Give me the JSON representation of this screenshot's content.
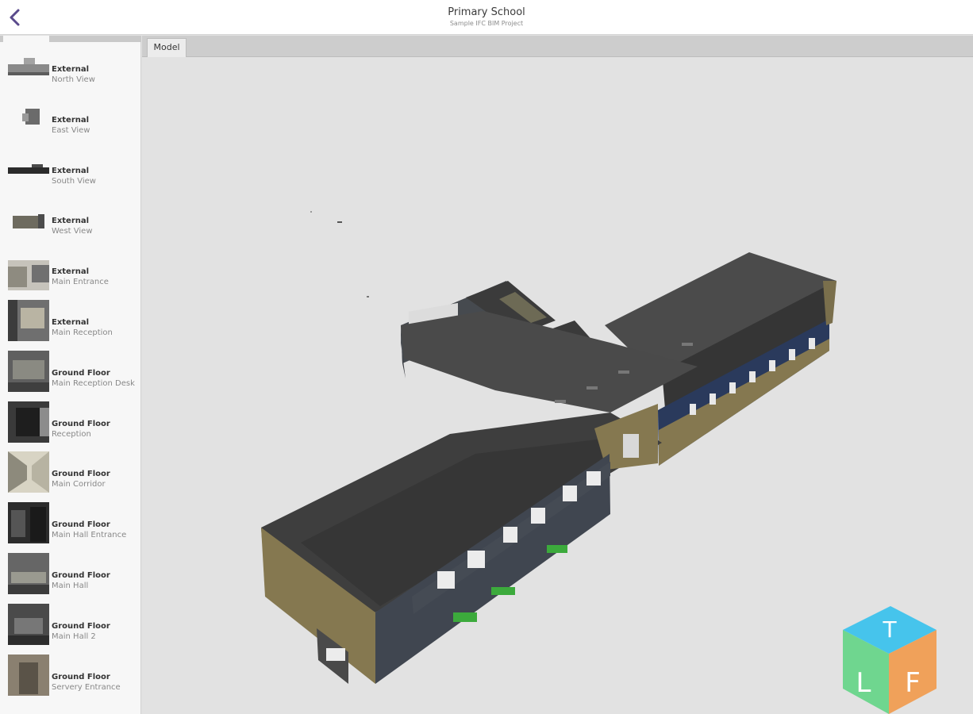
{
  "header": {
    "title": "Primary School",
    "subtitle": "Sample IFC BIM Project",
    "back_icon": "chevron-left-icon"
  },
  "colors": {
    "accent": "#5a4a8c",
    "roof": "#3f3f3f",
    "wall_tan": "#8a7c55",
    "wall_blue": "#27375a",
    "window_green": "#3caa3c",
    "logo_top": "#46c4ec",
    "logo_left": "#6fd68f",
    "logo_right": "#f0a15a"
  },
  "tabs": [
    {
      "label": "Model",
      "active": true
    }
  ],
  "views": [
    {
      "category": "External",
      "name": "North View"
    },
    {
      "category": "External",
      "name": "East View"
    },
    {
      "category": "External",
      "name": "South View"
    },
    {
      "category": "External",
      "name": "West View"
    },
    {
      "category": "External",
      "name": "Main Entrance"
    },
    {
      "category": "External",
      "name": "Main Reception"
    },
    {
      "category": "Ground Floor",
      "name": "Main Reception Desk"
    },
    {
      "category": "Ground Floor",
      "name": "Reception"
    },
    {
      "category": "Ground Floor",
      "name": "Main Corridor"
    },
    {
      "category": "Ground Floor",
      "name": "Main Hall Entrance"
    },
    {
      "category": "Ground Floor",
      "name": "Main Hall"
    },
    {
      "category": "Ground Floor",
      "name": "Main Hall 2"
    },
    {
      "category": "Ground Floor",
      "name": "Servery Entrance"
    }
  ],
  "logo": {
    "letters": [
      "T",
      "L",
      "F"
    ]
  }
}
